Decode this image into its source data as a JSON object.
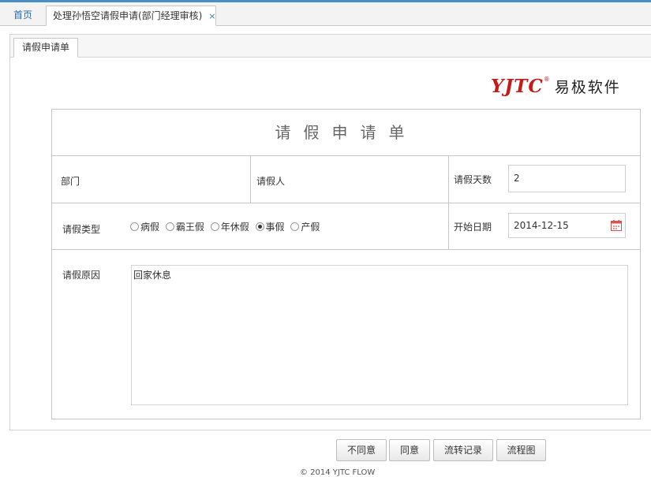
{
  "tabs": {
    "home": "首页",
    "active": "处理孙悟空请假申请(部门经理审核)",
    "close_glyph": "×"
  },
  "panel": {
    "subtab": "请假申请单"
  },
  "logo": {
    "en": "YJTC",
    "reg": "®",
    "cn": "易极软件"
  },
  "form": {
    "title": "请假申请单",
    "department_label": "部门",
    "department_value": "",
    "applicant_label": "请假人",
    "applicant_value": "",
    "days_label": "请假天数",
    "days_value": "2",
    "type_label": "请假类型",
    "types": [
      {
        "label": "病假",
        "checked": false
      },
      {
        "label": "霸王假",
        "checked": false
      },
      {
        "label": "年休假",
        "checked": false
      },
      {
        "label": "事假",
        "checked": true
      },
      {
        "label": "产假",
        "checked": false
      }
    ],
    "start_label": "开始日期",
    "start_value": "2014-12-15",
    "reason_label": "请假原因",
    "reason_value": "回家休息"
  },
  "buttons": {
    "disagree": "不同意",
    "agree": "同意",
    "history": "流转记录",
    "flowchart": "流程图"
  },
  "footer": {
    "text": "© 2014 YJTC FLOW"
  },
  "colors": {
    "accent": "#4a8ec6",
    "logo_red": "#c41a1a",
    "calendar_red": "#d9534f"
  },
  "icons": {
    "calendar": "calendar-icon",
    "close": "close-icon"
  }
}
